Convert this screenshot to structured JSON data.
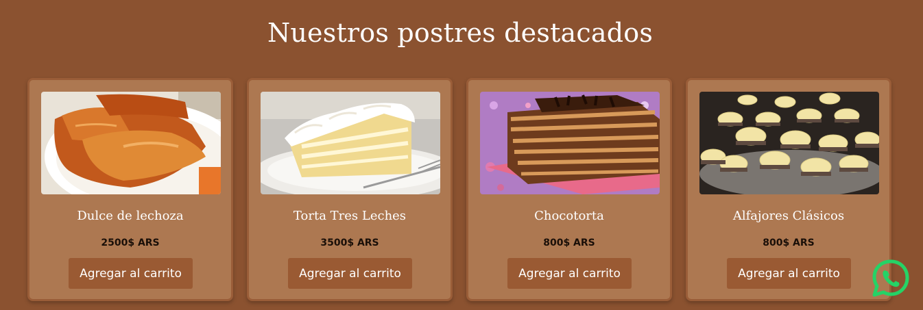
{
  "section": {
    "title": "Nuestros postres destacados"
  },
  "products": [
    {
      "name": "Dulce de lechoza",
      "price": "2500$ ARS",
      "button_label": "Agregar al carrito",
      "image_icon": "papaya-dessert-photo"
    },
    {
      "name": "Torta Tres Leches",
      "price": "3500$ ARS",
      "button_label": "Agregar al carrito",
      "image_icon": "tres-leches-cake-photo"
    },
    {
      "name": "Chocotorta",
      "price": "800$ ARS",
      "button_label": "Agregar al carrito",
      "image_icon": "chocotorta-photo"
    },
    {
      "name": "Alfajores Clásicos",
      "price": "800$ ARS",
      "button_label": "Agregar al carrito",
      "image_icon": "alfajores-photo"
    }
  ],
  "floating": {
    "whatsapp_icon": "whatsapp-icon"
  },
  "colors": {
    "background": "#8b5230",
    "card": "#ad7851",
    "card_border": "#9a5d38",
    "button": "#9a5a33",
    "whatsapp": "#25d366"
  }
}
